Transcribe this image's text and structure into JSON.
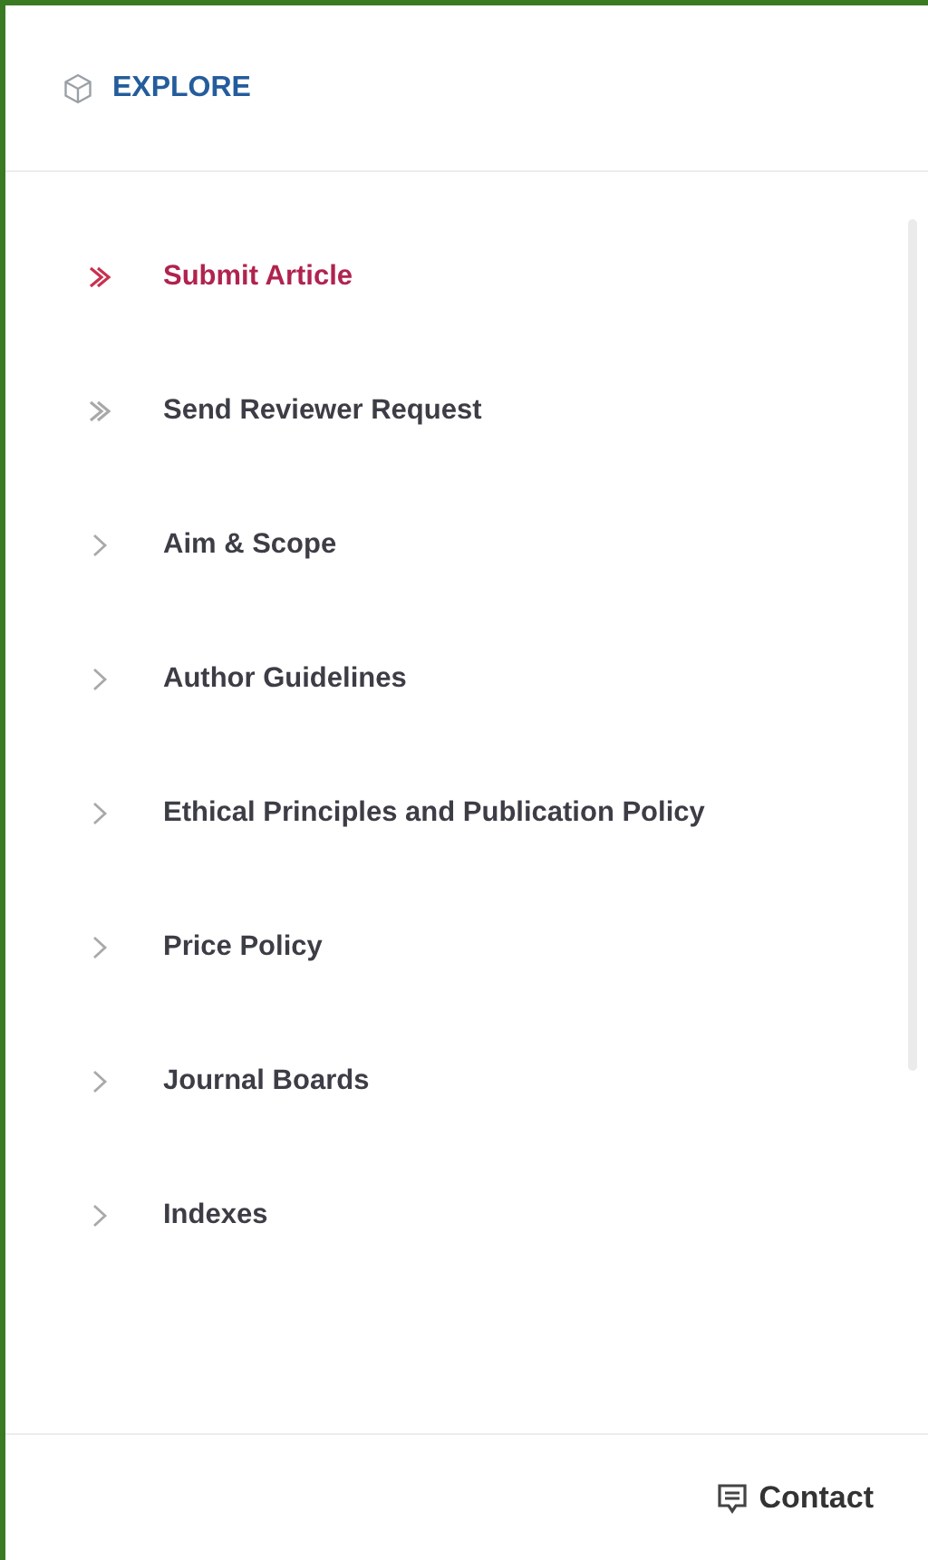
{
  "header": {
    "title": "EXPLORE"
  },
  "menu": [
    {
      "label": "Submit Article",
      "kind": "double",
      "selected": true
    },
    {
      "label": "Send Reviewer Request",
      "kind": "double",
      "selected": false
    },
    {
      "label": "Aim & Scope",
      "kind": "single",
      "selected": false
    },
    {
      "label": "Author Guidelines",
      "kind": "single",
      "selected": false
    },
    {
      "label": "Ethical Principles and Publication Policy",
      "kind": "single",
      "selected": false
    },
    {
      "label": "Price Policy",
      "kind": "single",
      "selected": false
    },
    {
      "label": "Journal Boards",
      "kind": "single",
      "selected": false
    },
    {
      "label": "Indexes",
      "kind": "single",
      "selected": false
    }
  ],
  "footer": {
    "link": "Contact"
  }
}
